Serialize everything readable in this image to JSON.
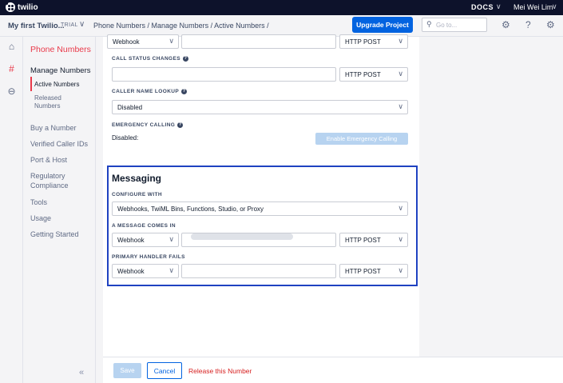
{
  "topbar": {
    "brand": "twilio",
    "docs": "DOCS",
    "user": "Mei Wei Lim"
  },
  "header": {
    "project": "My first Twilio...",
    "trial": "TRIAL",
    "breadcrumb": "Phone Numbers  /  Manage Numbers  /  Active Numbers  /",
    "upgrade": "Upgrade Project",
    "search_placeholder": "Go to..."
  },
  "sidebar": {
    "title": "Phone Numbers",
    "section": "Manage Numbers",
    "active_numbers": "Active Numbers",
    "released_numbers": "Released Numbers",
    "items": [
      "Buy a Number",
      "Verified Caller IDs",
      "Port & Host",
      "Regulatory Compliance",
      "Tools",
      "Usage",
      "Getting Started"
    ]
  },
  "voice": {
    "top_select": "Webhook",
    "top_method": "HTTP POST",
    "call_status_label": "CALL STATUS CHANGES",
    "call_status_method": "HTTP POST",
    "caller_name_label": "CALLER NAME LOOKUP",
    "caller_name_value": "Disabled",
    "emergency_label": "EMERGENCY CALLING",
    "emergency_status": "Disabled:",
    "emergency_button": "Enable Emergency Calling"
  },
  "messaging": {
    "title": "Messaging",
    "configure_label": "CONFIGURE WITH",
    "configure_value": "Webhooks, TwiML Bins, Functions, Studio, or Proxy",
    "comes_in_label": "A MESSAGE COMES IN",
    "comes_in_type": "Webhook",
    "comes_in_method": "HTTP POST",
    "fails_label": "PRIMARY HANDLER FAILS",
    "fails_type": "Webhook",
    "fails_method": "HTTP POST"
  },
  "footer": {
    "save": "Save",
    "cancel": "Cancel",
    "release": "Release this Number"
  },
  "icons": {
    "home": "home-icon",
    "numbers": "hash-icon",
    "more": "more-icon",
    "search": "search-icon",
    "bug": "bug-icon",
    "help": "help-icon",
    "settings": "gear-icon"
  },
  "colors": {
    "accent": "#0263e0",
    "brand_red": "#e93a4a",
    "highlight": "#1f42c1",
    "danger": "#d61f1f"
  }
}
